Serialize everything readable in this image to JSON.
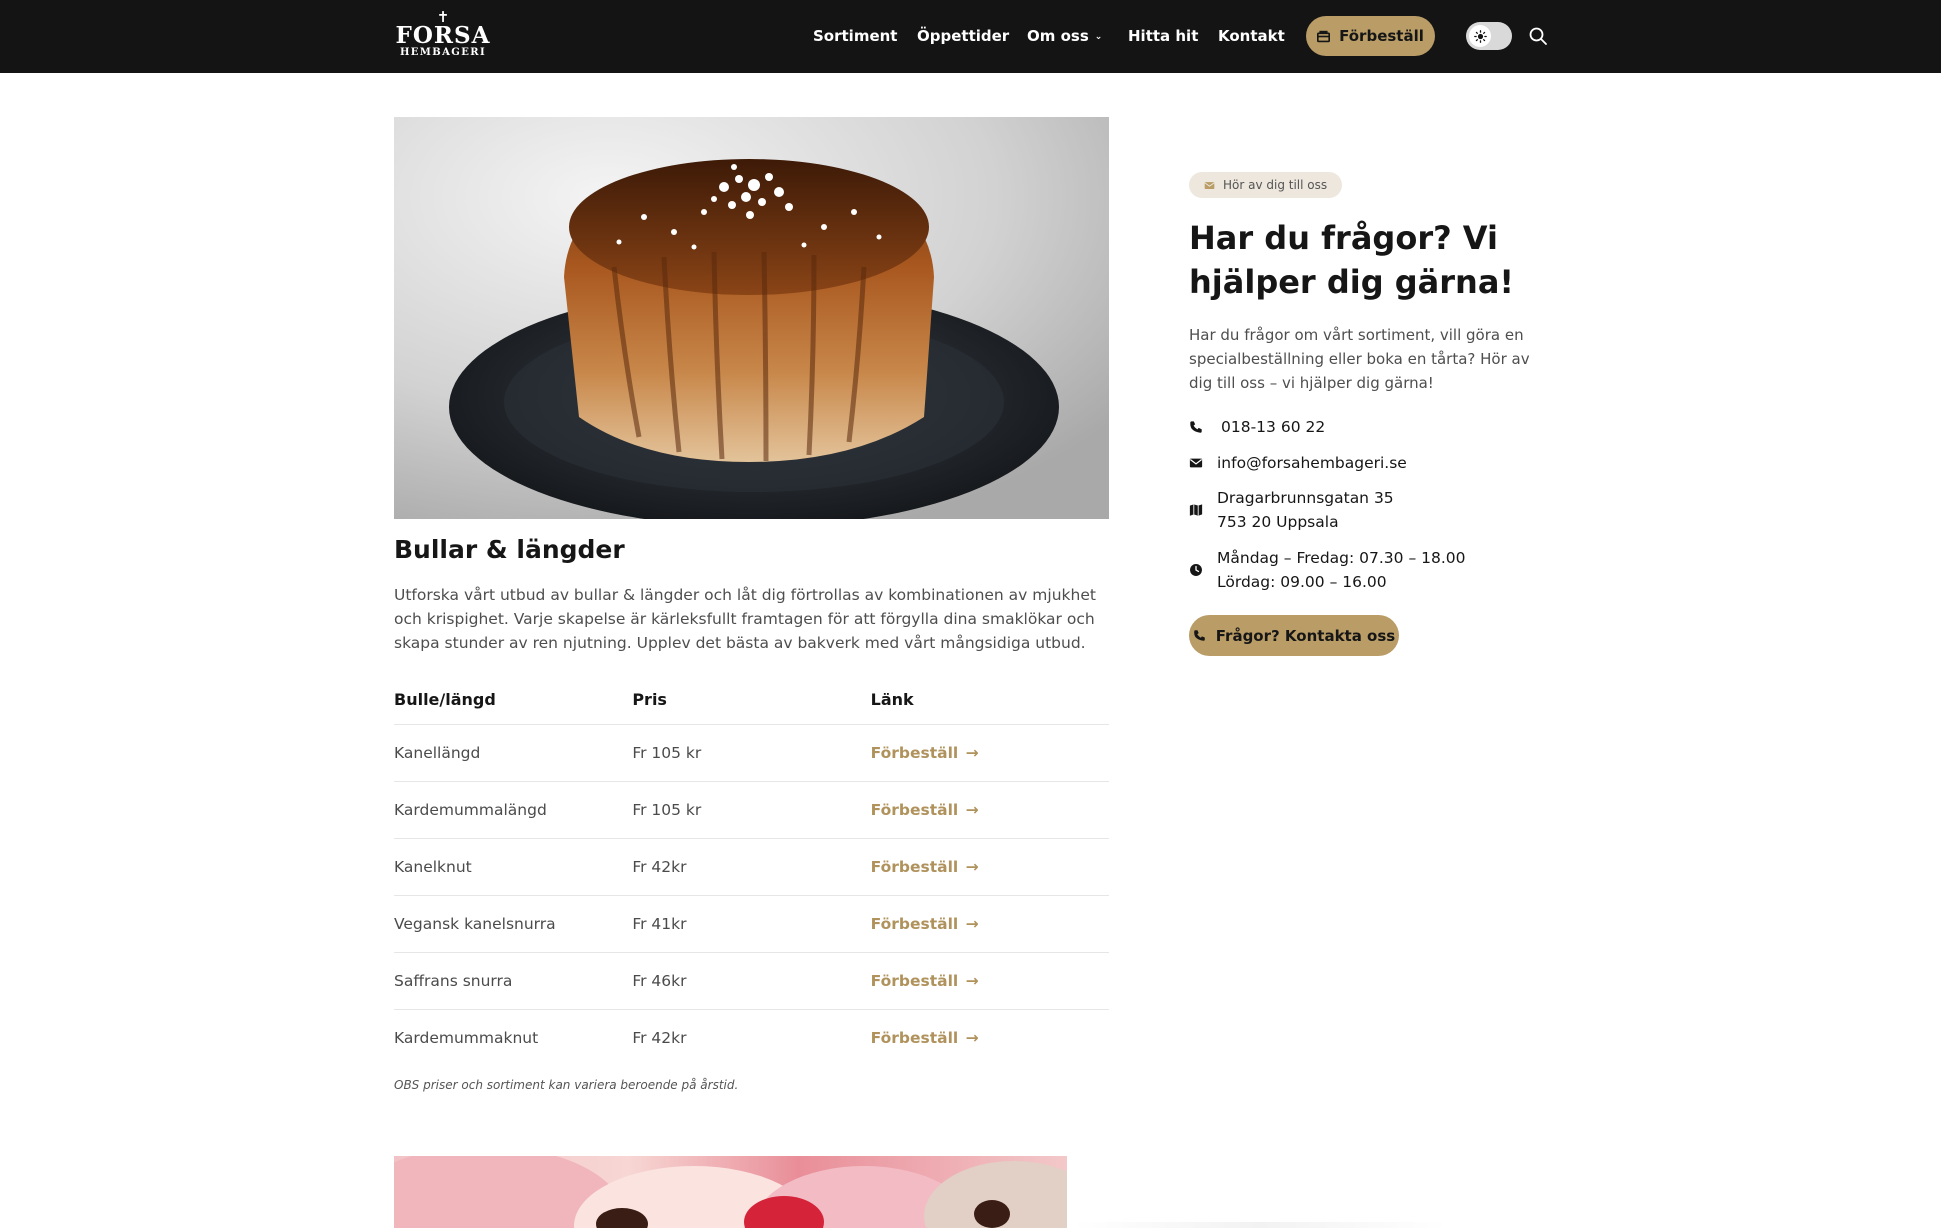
{
  "header": {
    "logo_cross": "✝",
    "logo_main": "FORSA",
    "logo_sub": "HEMBAGERI",
    "nav": [
      "Sortiment",
      "Öppettider",
      "Om oss",
      "Hitta hit",
      "Kontakt"
    ],
    "order_button": "Förbeställ",
    "colors": {
      "background": "#141414",
      "accent": "#b99c66"
    }
  },
  "main": {
    "title": "Bullar & längder",
    "intro": "Utforska vårt utbud av bullar & längder och låt dig förtrollas av kombinationen av mjukhet och krispighet. Varje skapelse är kärleksfullt framtagen för att förgylla dina smaklökar och skapa stunder av ren njutning. Upplev det bästa av bakverk med vårt mångsidiga utbud.",
    "table": {
      "headers": [
        "Bulle/längd",
        "Pris",
        "Länk"
      ],
      "rows": [
        {
          "name": "Kanellängd",
          "price": "Fr 105 kr",
          "link": "Förbeställ"
        },
        {
          "name": "Kardemummalängd",
          "price": "Fr 105 kr",
          "link": "Förbeställ"
        },
        {
          "name": "Kanelknut",
          "price": "Fr 42kr",
          "link": "Förbeställ"
        },
        {
          "name": "Vegansk kanelsnurra",
          "price": "Fr 41kr",
          "link": "Förbeställ"
        },
        {
          "name": "Saffrans snurra",
          "price": "Fr 46kr",
          "link": "Förbeställ"
        },
        {
          "name": "Kardemummaknut",
          "price": "Fr 42kr",
          "link": "Förbeställ"
        }
      ]
    },
    "note": "OBS priser och sortiment kan variera beroende på årstid."
  },
  "sidebar": {
    "badge": "Hör av dig till oss",
    "title": "Har du frågor? Vi hjälper dig gärna!",
    "text": "Har du frågor om vårt sortiment, vill göra en specialbeställning eller boka en tårta? Hör av dig till oss – vi hjälper dig gärna!",
    "phone": "018-13 60 22",
    "email": "info@forsahembageri.se",
    "address_line1": "Dragarbrunnsgatan 35",
    "address_line2": "753 20 Uppsala",
    "hours_line1": "Måndag – Fredag: 07.30 – 18.00",
    "hours_line2": "Lördag: 09.00 – 16.00",
    "button": "Frågor? Kontakta oss"
  },
  "icons": [
    "order-icon",
    "sun-icon",
    "search-icon",
    "envelope-icon",
    "phone-icon",
    "map-icon",
    "clock-icon",
    "arrow-right-icon"
  ]
}
